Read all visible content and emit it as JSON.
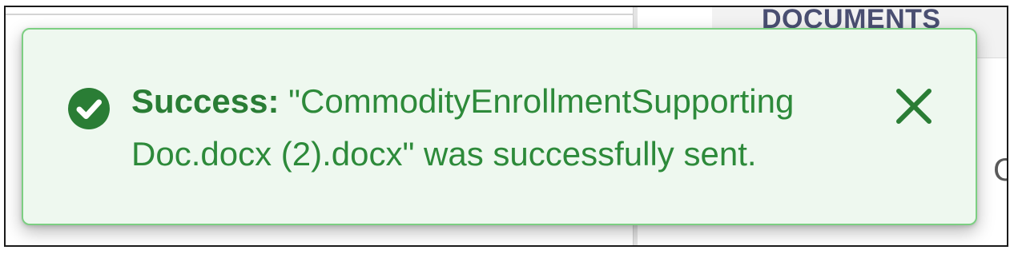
{
  "background": {
    "tab_label": "DOCUMENTS",
    "partial_letter": "C"
  },
  "toast": {
    "label": "Success:",
    "message": " \"CommodityEnrollmentSupporting Doc.docx (2).docx\" was successfully sent.",
    "icon": "check-circle-icon",
    "close_icon": "close-icon",
    "colors": {
      "background": "#eef8ef",
      "border": "#7ccf82",
      "text": "#2d8a3a",
      "icon": "#2a7d35"
    }
  }
}
